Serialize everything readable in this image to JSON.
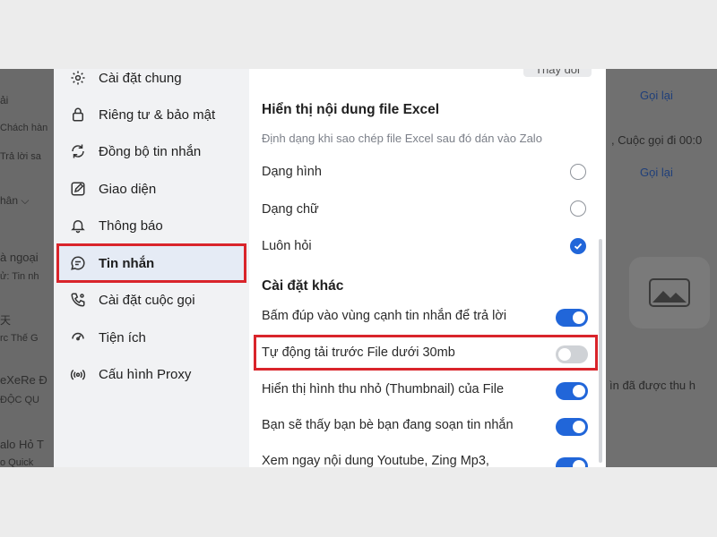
{
  "background": {
    "left_fragments": [
      "ải",
      "Chách hàn",
      "Trả lời sa",
      "hân ⌵",
      "à ngoại",
      "ử: Tin nh",
      "天",
      "rc Thế G",
      "eXeRe Đ",
      "ĐỘC QU",
      "alo Hỏ T",
      "o Quick"
    ],
    "right_fragments": {
      "link1": "Gọi lại",
      "call_text": ", Cuộc gọi đi 00:0",
      "link2": "Gọi lại",
      "file_text": "ìn đã được thu h"
    }
  },
  "sidebar": {
    "items": [
      {
        "label": "Cài đặt chung",
        "icon": "gear-icon"
      },
      {
        "label": "Riêng tư & bảo mật",
        "icon": "lock-icon"
      },
      {
        "label": "Đồng bộ tin nhắn",
        "icon": "sync-icon"
      },
      {
        "label": "Giao diện",
        "icon": "edit-icon"
      },
      {
        "label": "Thông báo",
        "icon": "bell-icon"
      },
      {
        "label": "Tin nhắn",
        "icon": "message-icon",
        "active": true
      },
      {
        "label": "Cài đặt cuộc gọi",
        "icon": "phone-settings-icon"
      },
      {
        "label": "Tiện ích",
        "icon": "utilities-icon"
      },
      {
        "label": "Cấu hình Proxy",
        "icon": "proxy-icon"
      }
    ]
  },
  "content": {
    "top_button": "Thay đổi",
    "excel": {
      "title": "Hiển thị nội dung file Excel",
      "subtitle": "Định dạng khi sao chép file Excel sau đó dán vào Zalo",
      "options": [
        {
          "label": "Dạng hình",
          "checked": false
        },
        {
          "label": "Dạng chữ",
          "checked": false
        },
        {
          "label": "Luôn hỏi",
          "checked": true
        }
      ]
    },
    "other": {
      "title": "Cài đặt khác",
      "toggles": [
        {
          "label": "Bấm đúp vào vùng cạnh tin nhắn để trả lời",
          "on": true
        },
        {
          "label": "Tự động tải trước File dưới 30mb",
          "on": false
        },
        {
          "label": "Hiển thị hình thu nhỏ (Thumbnail) của File",
          "on": true
        },
        {
          "label": "Bạn sẽ thấy bạn bè bạn đang soạn tin nhắn",
          "on": true
        },
        {
          "label": "Xem ngay nội dung Youtube, Zing Mp3,",
          "on": true
        }
      ]
    }
  },
  "colors": {
    "accent": "#2166d9",
    "highlight": "#d9242b"
  }
}
